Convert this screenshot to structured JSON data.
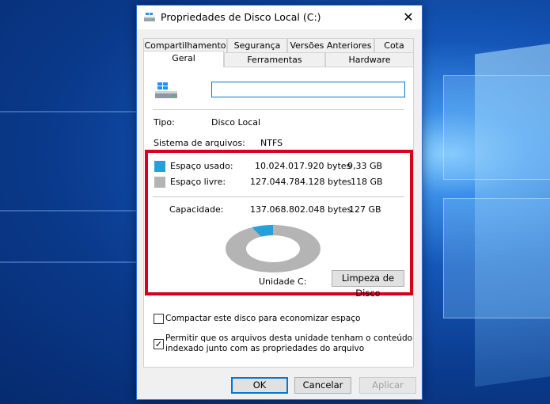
{
  "window": {
    "title": "Propriedades de Disco Local (C:)",
    "close_symbol": "✕"
  },
  "tabs_row1": [
    {
      "label": "Compartilhamento"
    },
    {
      "label": "Segurança"
    },
    {
      "label": "Versões Anteriores"
    },
    {
      "label": "Cota"
    }
  ],
  "tabs_row2": [
    {
      "label": "Geral",
      "active": true
    },
    {
      "label": "Ferramentas"
    },
    {
      "label": "Hardware"
    }
  ],
  "general": {
    "drive_name_value": "",
    "type_label": "Tipo:",
    "type_value": "Disco Local",
    "fs_label": "Sistema de arquivos:",
    "fs_value": "NTFS",
    "used_label": "Espaço usado:",
    "used_bytes": "10.024.017.920 bytes",
    "used_gb": "9,33 GB",
    "free_label": "Espaço livre:",
    "free_bytes": "127.044.784.128 bytes",
    "free_gb": "118 GB",
    "capacity_label": "Capacidade:",
    "capacity_bytes": "137.068.802.048 bytes",
    "capacity_gb": "127 GB",
    "drive_label": "Unidade C:",
    "cleanup_button": "Limpeza de Disco",
    "used_fraction": 0.073,
    "used_color": "#26a0da",
    "free_color": "#b4b4b4",
    "highlight_color": "#d6001c"
  },
  "options": {
    "compress_label": "Compactar este disco para economizar espaço",
    "compress_checked": false,
    "index_label_line1": "Permitir que os arquivos desta unidade tenham o conteúdo",
    "index_label_line2": "indexado junto com as propriedades do arquivo",
    "index_checked": true
  },
  "buttons": {
    "ok": "OK",
    "cancel": "Cancelar",
    "apply": "Aplicar"
  }
}
